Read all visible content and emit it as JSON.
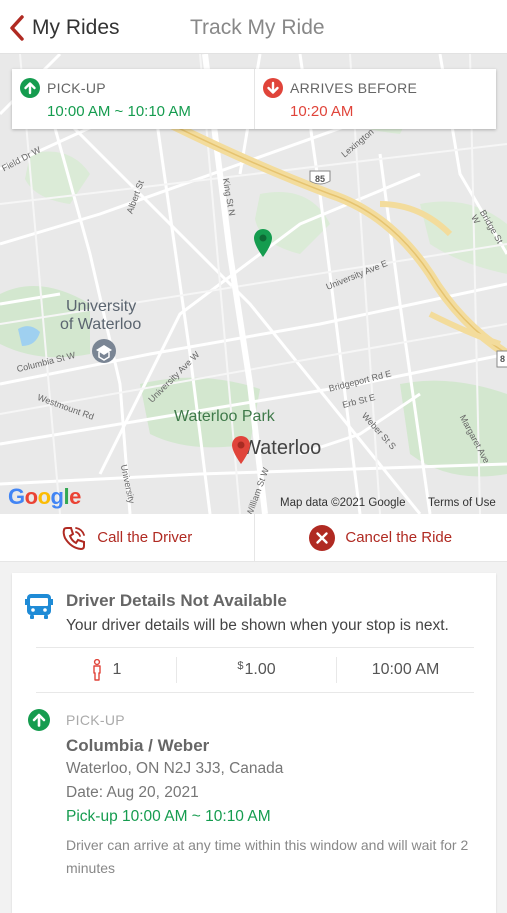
{
  "header": {
    "back_label": "My Rides",
    "title": "Track My Ride"
  },
  "time_card": {
    "pickup_label": "PICK-UP",
    "pickup_value": "10:00 AM ~ 10:10 AM",
    "arrives_label": "ARRIVES BEFORE",
    "arrives_value": "10:20 AM"
  },
  "map": {
    "labels": {
      "university": "University",
      "of_waterloo": "of Waterloo",
      "waterloo_park": "Waterloo Park",
      "waterloo": "Waterloo",
      "columbia": "Columbia St W",
      "westmount": "Westmount Rd",
      "university_ave": "University Ave E",
      "university_ave_w": "University Ave W",
      "bridgeport": "Bridgeport Rd E",
      "erb": "Erb St E",
      "weber": "Weber St S",
      "margaret": "Margaret Ave",
      "king": "King St N",
      "albert": "Albert St",
      "lexington": "Lexington",
      "bridge": "Bridge St W",
      "highway": "85",
      "highway2": "8",
      "field": "Field Dr W",
      "university_rd": "University",
      "william": "William St W"
    },
    "google": "Google",
    "attribution": "Map data ©2021 Google",
    "terms": "Terms of Use"
  },
  "actions": {
    "call": "Call the Driver",
    "cancel": "Cancel the Ride"
  },
  "details": {
    "title": "Driver Details Not Available",
    "subtitle": "Your driver details will be shown when your stop is next.",
    "passengers": "1",
    "currency": "$",
    "fare": "1.00",
    "time": "10:00 AM",
    "pickup_label": "PICK-UP",
    "pickup_name": "Columbia / Weber",
    "pickup_address": "Waterloo, ON N2J 3J3, Canada",
    "pickup_date": "Date: Aug 20, 2021",
    "pickup_window": "Pick-up 10:00 AM ~ 10:10 AM",
    "pickup_note": "Driver can arrive at any time within this window and will wait for 2 minutes"
  },
  "colors": {
    "brand": "#b02a22",
    "green": "#159c4f",
    "red": "#e0443a",
    "bus": "#1f8bd6"
  }
}
